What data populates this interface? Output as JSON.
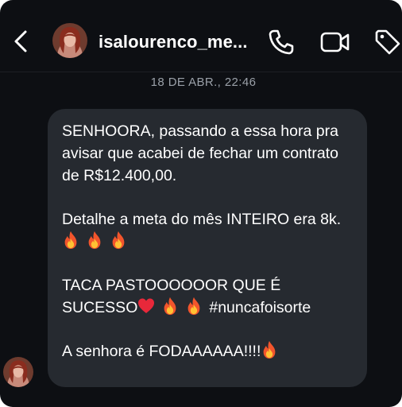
{
  "header": {
    "username": "isalourenco_me...",
    "icons": [
      "back-icon",
      "avatar",
      "phone-icon",
      "video-icon",
      "tag-icon"
    ]
  },
  "conversation": {
    "timestamp": "18 DE ABR., 22:46",
    "message": {
      "line1": "SENHOORA, passando a essa hora pra avisar que acabei de fechar um contrato de R$12.400,00.",
      "line2_text": "Detalhe a meta do mês INTEIRO era 8k.",
      "line3_text": "TACA PASTOOOOOOR QUE É SUCESSO",
      "line3_tag": "#nuncafoisorte",
      "line4_text": "A senhora é FODAAAAAA!!!!"
    }
  },
  "colors": {
    "background": "#0d0f13",
    "bubble": "#262a30",
    "text": "#ffffff",
    "timestamp": "#9aa0a8"
  }
}
